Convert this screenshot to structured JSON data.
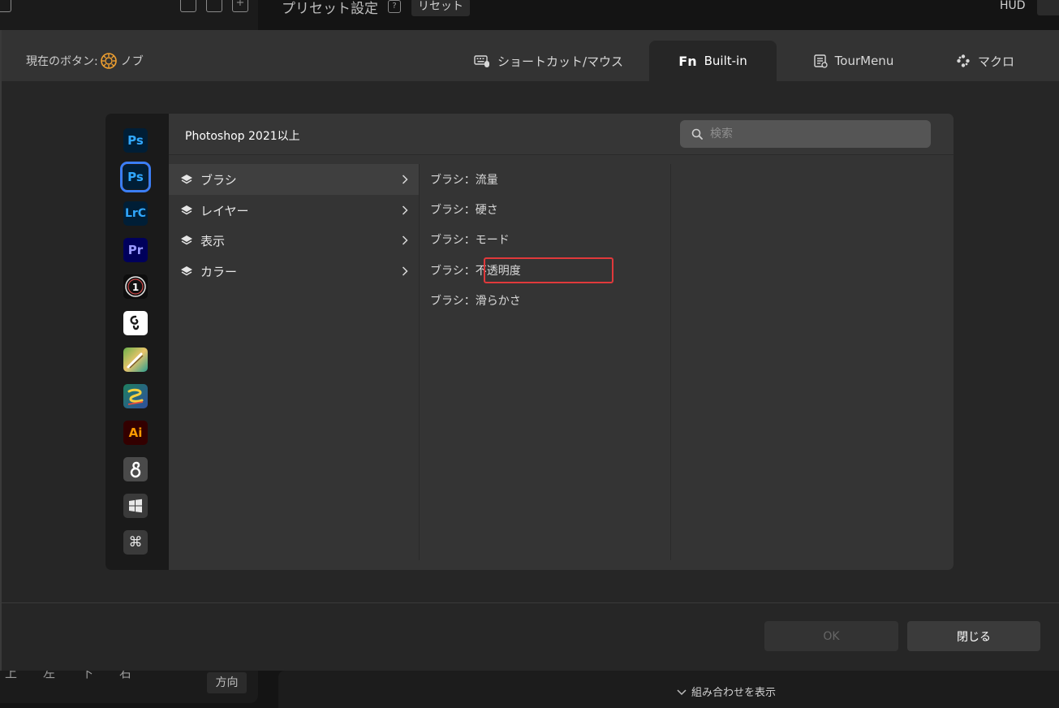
{
  "background": {
    "title": "プリセット設定",
    "help": "?",
    "reset_label": "リセット",
    "hud_label": "HUD",
    "directions": [
      "上",
      "左",
      "下",
      "右"
    ],
    "direction_button": "方向",
    "combo_label": "組み合わせを表示"
  },
  "dialog": {
    "current_label": "現在のボタン:",
    "current_value": "ノブ",
    "tabs": [
      {
        "label": "ショートカット/マウス",
        "icon": "keyboard-mouse-icon"
      },
      {
        "label": "Built-in",
        "icon": "fn-icon",
        "prefix": "Fn"
      },
      {
        "label": "TourMenu",
        "icon": "tourmenu-icon"
      },
      {
        "label": "マクロ",
        "icon": "macro-icon"
      }
    ],
    "active_tab": "Built-in",
    "ok_label": "OK",
    "close_label": "閉じる"
  },
  "panel": {
    "title": "Photoshop 2021以上",
    "search_placeholder": "検索",
    "apps": [
      {
        "label": "Ps",
        "name": "photoshop-icon",
        "color": "#31a8ff",
        "bg": "#001e36"
      },
      {
        "label": "Ps",
        "name": "photoshop-2021-icon",
        "color": "#31a8ff",
        "bg": "#001e36",
        "selected": true
      },
      {
        "label": "LrC",
        "name": "lightroom-classic-icon",
        "color": "#31a8ff",
        "bg": "#001e36"
      },
      {
        "label": "Pr",
        "name": "premiere-pro-icon",
        "color": "#9999ff",
        "bg": "#00005b"
      },
      {
        "label": "",
        "name": "capture-one-icon"
      },
      {
        "label": "",
        "name": "clip-studio-icon"
      },
      {
        "label": "",
        "name": "krita-icon"
      },
      {
        "label": "",
        "name": "sketchbook-icon"
      },
      {
        "label": "Ai",
        "name": "illustrator-icon",
        "color": "#ff9a00",
        "bg": "#330000"
      },
      {
        "label": "",
        "name": "affinity-icon"
      },
      {
        "label": "",
        "name": "windows-icon"
      },
      {
        "label": "⌘",
        "name": "mac-command-icon"
      }
    ],
    "categories": [
      {
        "label": "ブラシ",
        "active": true
      },
      {
        "label": "レイヤー",
        "active": false
      },
      {
        "label": "表示",
        "active": false
      },
      {
        "label": "カラー",
        "active": false
      }
    ],
    "actions": [
      "ブラシ：流量",
      "ブラシ：硬さ",
      "ブラシ：モード",
      "ブラシ：不透明度",
      "ブラシ：滑らかさ"
    ],
    "highlighted_action": "ブラシ：不透明度"
  },
  "colors": {
    "accent": "#3b7ef6",
    "highlight": "#e0393b",
    "knob": "#f0a030"
  }
}
